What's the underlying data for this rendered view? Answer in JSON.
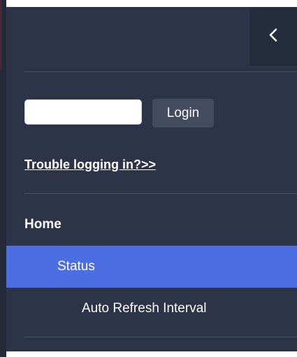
{
  "sidebar": {
    "collapse_icon": "chevron-left-icon",
    "login": {
      "input_value": "",
      "input_placeholder": "",
      "button_label": "Login"
    },
    "trouble_link": "Trouble logging in?>>",
    "nav": {
      "home": "Home",
      "status": "Status",
      "auto_refresh": "Auto Refresh Interval"
    }
  },
  "colors": {
    "sidebar_bg": "#2d3447",
    "active_item_bg": "#4b6ee3",
    "button_bg": "#434b5f",
    "text": "#ffffff"
  }
}
